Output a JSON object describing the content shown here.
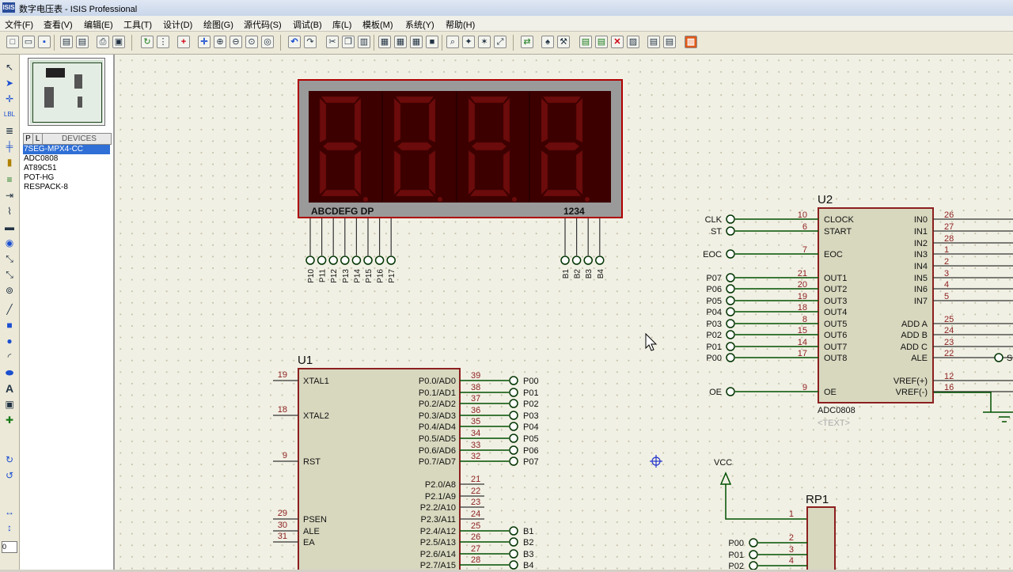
{
  "window": {
    "title": "数字电压表 - ISIS Professional",
    "app_icon": "ISIS"
  },
  "menu": [
    "文件(F)",
    "查看(V)",
    "编辑(E)",
    "工具(T)",
    "设计(D)",
    "绘图(G)",
    "源代码(S)",
    "调试(B)",
    "库(L)",
    "模板(M)",
    "系统(Y)",
    "帮助(H)"
  ],
  "side_panel": {
    "tab_p": "P",
    "tab_l": "L",
    "devices_header": "DEVICES",
    "devices": [
      "7SEG-MPX4-CC",
      "ADC0808",
      "AT89C51",
      "POT-HG",
      "RESPACK-8"
    ],
    "selected_device": "7SEG-MPX4-CC"
  },
  "zoom_field": "0",
  "schematic": {
    "seven_segment": {
      "digits_shown": "8888",
      "segment_label": "ABCDEFG DP",
      "digit_label": "1234",
      "seg_pins": [
        "P10",
        "P11",
        "P12",
        "P13",
        "P14",
        "P15",
        "P16",
        "P17"
      ],
      "digit_pins": [
        "B1",
        "B2",
        "B3",
        "B4"
      ],
      "colors": {
        "display_bg": "#3c0000",
        "segment_off": "#6c0b0b",
        "frame": "#8c8c8c",
        "bezel": "#b00000"
      }
    },
    "u2": {
      "ref": "U2",
      "part": "ADC0808",
      "text_placeholder": "<TEXT>",
      "left_pins": [
        {
          "num": "10",
          "name": "CLOCK",
          "net": "CLK"
        },
        {
          "num": "6",
          "name": "START",
          "net": "ST"
        },
        {
          "num": "7",
          "name": "EOC",
          "net": "EOC"
        },
        {
          "num": "21",
          "name": "OUT1",
          "net": "P07"
        },
        {
          "num": "20",
          "name": "OUT2",
          "net": "P06"
        },
        {
          "num": "19",
          "name": "OUT3",
          "net": "P05"
        },
        {
          "num": "18",
          "name": "OUT4",
          "net": "P04"
        },
        {
          "num": "8",
          "name": "OUT5",
          "net": "P03"
        },
        {
          "num": "15",
          "name": "OUT6",
          "net": "P02"
        },
        {
          "num": "14",
          "name": "OUT7",
          "net": "P01"
        },
        {
          "num": "17",
          "name": "OUT8",
          "net": "P00"
        },
        {
          "num": "9",
          "name": "OE",
          "net": "OE"
        }
      ],
      "right_pins": [
        {
          "num": "26",
          "name": "IN0"
        },
        {
          "num": "27",
          "name": "IN1"
        },
        {
          "num": "28",
          "name": "IN2"
        },
        {
          "num": "1",
          "name": "IN3"
        },
        {
          "num": "2",
          "name": "IN4"
        },
        {
          "num": "3",
          "name": "IN5"
        },
        {
          "num": "4",
          "name": "IN6"
        },
        {
          "num": "5",
          "name": "IN7"
        },
        {
          "num": "25",
          "name": "ADD A"
        },
        {
          "num": "24",
          "name": "ADD B"
        },
        {
          "num": "23",
          "name": "ADD C"
        },
        {
          "num": "22",
          "name": "ALE"
        },
        {
          "num": "12",
          "name": "VREF(+)"
        },
        {
          "num": "16",
          "name": "VREF(-)"
        }
      ],
      "ale_net": "S"
    },
    "u1": {
      "ref": "U1",
      "left_pins": [
        {
          "num": "19",
          "name": "XTAL1"
        },
        {
          "num": "18",
          "name": "XTAL2"
        },
        {
          "num": "9",
          "name": "RST"
        },
        {
          "num": "29",
          "name": "PSEN"
        },
        {
          "num": "30",
          "name": "ALE"
        },
        {
          "num": "31",
          "name": "EA"
        }
      ],
      "right_pins": [
        {
          "num": "39",
          "name": "P0.0/AD0",
          "net": "P00"
        },
        {
          "num": "38",
          "name": "P0.1/AD1",
          "net": "P01"
        },
        {
          "num": "37",
          "name": "P0.2/AD2",
          "net": "P02"
        },
        {
          "num": "36",
          "name": "P0.3/AD3",
          "net": "P03"
        },
        {
          "num": "35",
          "name": "P0.4/AD4",
          "net": "P04"
        },
        {
          "num": "34",
          "name": "P0.5/AD5",
          "net": "P05"
        },
        {
          "num": "33",
          "name": "P0.6/AD6",
          "net": "P06"
        },
        {
          "num": "32",
          "name": "P0.7/AD7",
          "net": "P07"
        },
        {
          "num": "21",
          "name": "P2.0/A8",
          "net": ""
        },
        {
          "num": "22",
          "name": "P2.1/A9",
          "net": ""
        },
        {
          "num": "23",
          "name": "P2.2/A10",
          "net": ""
        },
        {
          "num": "24",
          "name": "P2.3/A11",
          "net": ""
        },
        {
          "num": "25",
          "name": "P2.4/A12",
          "net": "B1"
        },
        {
          "num": "26",
          "name": "P2.5/A13",
          "net": "B2"
        },
        {
          "num": "27",
          "name": "P2.6/A14",
          "net": "B3"
        },
        {
          "num": "28",
          "name": "P2.7/A15",
          "net": "B4"
        }
      ]
    },
    "rp1": {
      "ref": "RP1",
      "pins": [
        {
          "num": "1",
          "net": ""
        },
        {
          "num": "2",
          "net": "P00"
        },
        {
          "num": "3",
          "net": "P01"
        },
        {
          "num": "4",
          "net": "P02"
        }
      ]
    },
    "vcc_label": "VCC",
    "colors": {
      "wire": "#005000",
      "body": "#d8d8bf",
      "body_border": "#8c1f1f",
      "pin_num": "#8c1f1f",
      "text": "#000000",
      "terminal": "#003300",
      "canvas": "#f1f0e4"
    }
  }
}
